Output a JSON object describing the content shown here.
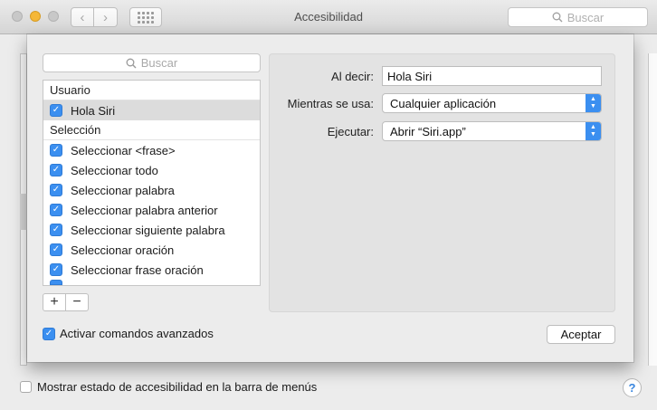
{
  "window": {
    "title": "Accesibilidad",
    "search_placeholder": "Buscar"
  },
  "background": {
    "show_status_label": "Mostrar estado de accesibilidad en la barra de menús",
    "help_label": "?"
  },
  "sheet": {
    "search_placeholder": "Buscar",
    "list": {
      "group_user": "Usuario",
      "user_items": [
        {
          "label": "Hola Siri",
          "checked": true
        }
      ],
      "group_selection": "Selección",
      "selection_items": [
        {
          "label": "Seleccionar <frase>",
          "checked": true
        },
        {
          "label": "Seleccionar todo",
          "checked": true
        },
        {
          "label": "Seleccionar palabra",
          "checked": true
        },
        {
          "label": "Seleccionar palabra anterior",
          "checked": true
        },
        {
          "label": "Seleccionar siguiente palabra",
          "checked": true
        },
        {
          "label": "Seleccionar oración",
          "checked": true
        },
        {
          "label": "Seleccionar frase oración",
          "checked": true
        }
      ]
    },
    "add_label": "+",
    "remove_label": "−",
    "advanced_label": "Activar comandos avanzados",
    "detail": {
      "say_label": "Al decir:",
      "say_value": "Hola Siri",
      "while_label": "Mientras se usa:",
      "while_value": "Cualquier aplicación",
      "perform_label": "Ejecutar:",
      "perform_value": "Abrir “Siri.app”"
    },
    "accept_label": "Aceptar"
  },
  "colors": {
    "accent": "#3b8ff0",
    "minimize": "#f5b737"
  }
}
